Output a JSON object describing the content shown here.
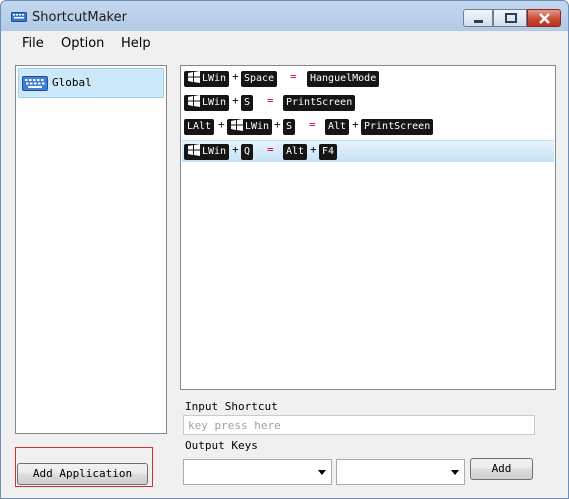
{
  "window": {
    "title": "ShortcutMaker"
  },
  "menu": [
    "File",
    "Option",
    "Help"
  ],
  "applications": [
    {
      "name": "Global",
      "icon": "keyboard-icon"
    }
  ],
  "shortcuts": [
    {
      "selected": false,
      "keys": [
        "LWin",
        "Space"
      ],
      "output": [
        "HanguelMode"
      ]
    },
    {
      "selected": false,
      "keys": [
        "LWin",
        "S"
      ],
      "output": [
        "PrintScreen"
      ]
    },
    {
      "selected": false,
      "keys": [
        "LAlt",
        "LWin",
        "S"
      ],
      "output": [
        "Alt",
        "PrintScreen"
      ]
    },
    {
      "selected": true,
      "keys": [
        "LWin",
        "Q"
      ],
      "output": [
        "Alt",
        "F4"
      ]
    }
  ],
  "input_shortcut": {
    "label": "Input Shortcut",
    "placeholder": "key press here"
  },
  "output_keys": {
    "label": "Output Keys",
    "select1": "",
    "select2": ""
  },
  "buttons": {
    "add": "Add",
    "add_application": "Add Application"
  },
  "colors": {
    "chip_bg": "#151515",
    "equals": "#d3004a",
    "selection": "#cde8f8"
  }
}
